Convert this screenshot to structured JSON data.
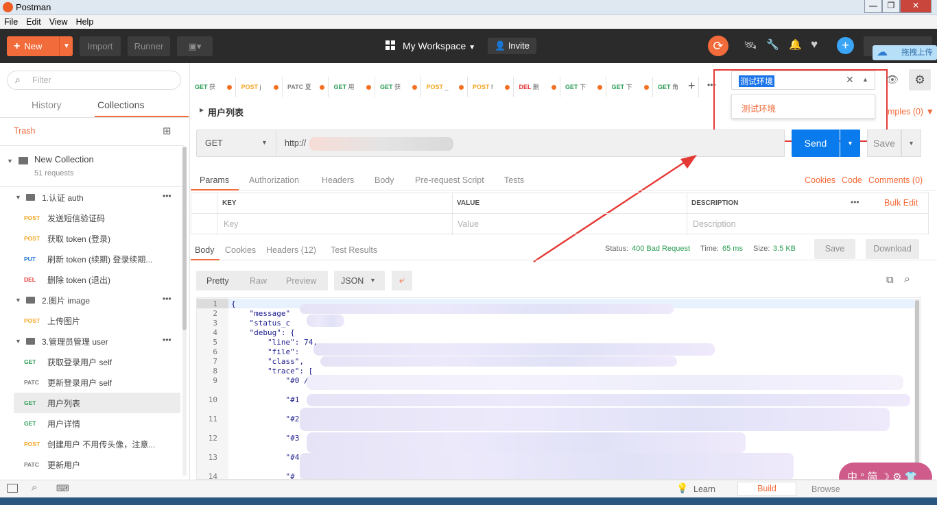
{
  "window": {
    "title": "Postman",
    "min": "—",
    "max": "❐",
    "close": "✕"
  },
  "menu": [
    "File",
    "Edit",
    "View",
    "Help"
  ],
  "header": {
    "new_label": "New",
    "import_label": "Import",
    "runner_label": "Runner",
    "workspace_label": "My Workspace",
    "invite_label": "Invite",
    "badge_label": "拖拽上传"
  },
  "sidebar": {
    "filter_placeholder": "Filter",
    "tab_history": "History",
    "tab_collections": "Collections",
    "trash_label": "Trash",
    "collection_name": "New Collection",
    "collection_count": "51 requests",
    "items": [
      {
        "type": "folder",
        "label": "1.认证 auth"
      },
      {
        "type": "request",
        "method": "POST",
        "label": "发送短信验证码"
      },
      {
        "type": "request",
        "method": "POST",
        "label": "获取 token (登录)"
      },
      {
        "type": "request",
        "method": "PUT",
        "label": "刷新 token (续期) 登录续期..."
      },
      {
        "type": "request",
        "method": "DEL",
        "label": "删除 token (退出)"
      },
      {
        "type": "folder",
        "label": "2.图片 image"
      },
      {
        "type": "request",
        "method": "POST",
        "label": "上传图片"
      },
      {
        "type": "folder",
        "label": "3.管理员管理 user"
      },
      {
        "type": "request",
        "method": "GET",
        "label": "获取登录用户 self"
      },
      {
        "type": "request",
        "method": "PATC",
        "label": "更新登录用户 self"
      },
      {
        "type": "request",
        "method": "GET",
        "label": "用户列表",
        "selected": true
      },
      {
        "type": "request",
        "method": "GET",
        "label": "用户详情"
      },
      {
        "type": "request",
        "method": "POST",
        "label": "创建用户 不用传头像，注意..."
      },
      {
        "type": "request",
        "method": "PATC",
        "label": "更新用户"
      }
    ]
  },
  "tabs": [
    {
      "method": "GET",
      "label": "获"
    },
    {
      "method": "POST",
      "label": "j"
    },
    {
      "method": "PATC",
      "label": "夏"
    },
    {
      "method": "GET",
      "label": "用"
    },
    {
      "method": "GET",
      "label": "获"
    },
    {
      "method": "POST",
      "label": "_"
    },
    {
      "method": "POST",
      "label": "f"
    },
    {
      "method": "DEL",
      "label": "删"
    },
    {
      "method": "GET",
      "label": "下"
    },
    {
      "method": "GET",
      "label": "下"
    },
    {
      "method": "GET",
      "label": "角"
    }
  ],
  "environment": {
    "selected": "测试环境",
    "options": [
      "测试环境"
    ]
  },
  "request": {
    "name": "用户列表",
    "examples_label": "mples (0)",
    "method": "GET",
    "url": "http://",
    "send_label": "Send",
    "save_label": "Save",
    "subtabs": [
      "Params",
      "Authorization",
      "Headers",
      "Body",
      "Pre-request Script",
      "Tests"
    ],
    "right_links": [
      "Cookies",
      "Code",
      "Comments (0)"
    ],
    "params_table": {
      "headers": [
        "KEY",
        "VALUE",
        "DESCRIPTION"
      ],
      "bulk_edit": "Bulk Edit",
      "placeholders": [
        "Key",
        "Value",
        "Description"
      ]
    }
  },
  "response": {
    "tabs": [
      "Body",
      "Cookies",
      "Headers (12)",
      "Test Results"
    ],
    "status_label": "Status:",
    "status_value": "400 Bad Request",
    "time_label": "Time:",
    "time_value": "65 ms",
    "size_label": "Size:",
    "size_value": "3.5 KB",
    "save_label": "Save",
    "download_label": "Download",
    "views": [
      "Pretty",
      "Raw",
      "Preview"
    ],
    "format": "JSON",
    "code_lines": [
      {
        "n": "1",
        "text": "{"
      },
      {
        "n": "2",
        "text": "    \"message\""
      },
      {
        "n": "3",
        "text": "    \"status_c"
      },
      {
        "n": "4",
        "text": "    \"debug\": {"
      },
      {
        "n": "5",
        "text": "        \"line\": 74,"
      },
      {
        "n": "6",
        "text": "        \"file\":"
      },
      {
        "n": "7",
        "text": "        \"class\","
      },
      {
        "n": "8",
        "text": "        \"trace\": ["
      },
      {
        "n": "9",
        "text": "            \"#0 /"
      },
      {
        "n": "10",
        "text": "            \"#1"
      },
      {
        "n": "11",
        "text": "            \"#2"
      },
      {
        "n": "12",
        "text": "            \"#3"
      },
      {
        "n": "13",
        "text": "            \"#4"
      },
      {
        "n": "14",
        "text": "            \"#"
      }
    ]
  },
  "statusbar": {
    "learn_label": "Learn",
    "build_label": "Build",
    "browse_label": "Browse"
  },
  "ime": {
    "text": "中 ° 简 ☽ ⚙ 👕"
  },
  "colors": {
    "accent": "#f26b3a",
    "send": "#097bed",
    "get": "#2a9c54",
    "post": "#f5a623",
    "put": "#2573d5",
    "del": "#e63434",
    "patch": "#7d7d7d",
    "annotation": "#e53935"
  }
}
